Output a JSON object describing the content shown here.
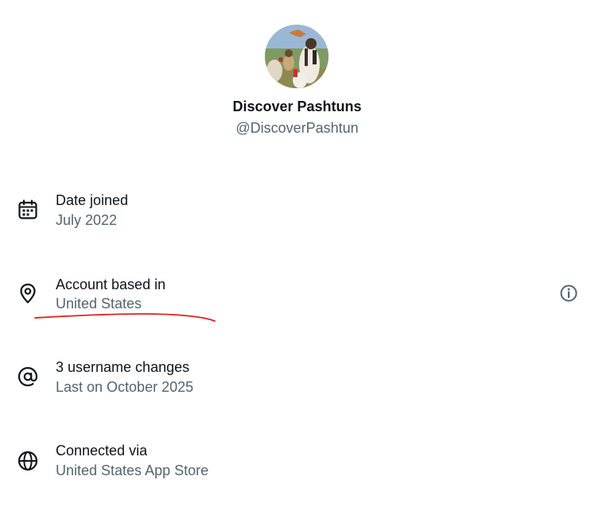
{
  "profile": {
    "display_name": "Discover Pashtuns",
    "handle": "@DiscoverPashtun",
    "avatar_icon": "profile-photo"
  },
  "about": {
    "date_joined": {
      "title": "Date joined",
      "value": "July 2022",
      "icon": "calendar-icon"
    },
    "account_based_in": {
      "title": "Account based in",
      "value": "United States",
      "icon": "location-pin-icon",
      "info_icon": "info-icon"
    },
    "username_changes": {
      "title": "3 username changes",
      "value": "Last on October 2025",
      "icon": "at-sign-icon"
    },
    "connected_via": {
      "title": "Connected via",
      "value": "United States App Store",
      "icon": "globe-icon"
    }
  },
  "colors": {
    "primary_text": "#0f1419",
    "secondary_text": "#536471",
    "annotation": "#e0211f"
  }
}
